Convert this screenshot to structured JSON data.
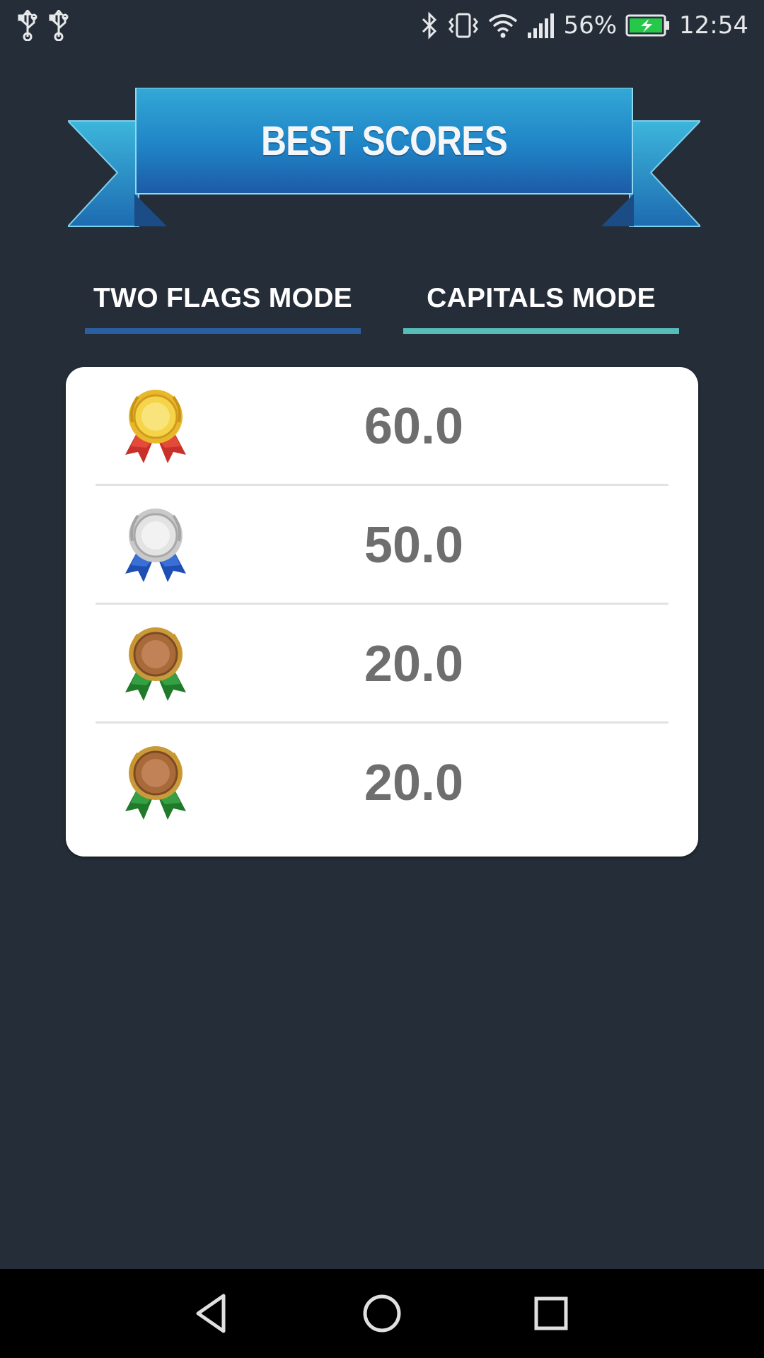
{
  "status_bar": {
    "left_icons": [
      "usb-icon",
      "usb-icon"
    ],
    "right_icons": [
      "bluetooth-icon",
      "vibrate-icon",
      "wifi-icon",
      "signal-icon"
    ],
    "battery": "56%",
    "time": "12:54",
    "battery_icon": "battery-charging-icon"
  },
  "banner": {
    "title": "BEST SCORES"
  },
  "tabs": [
    {
      "label": "TWO FLAGS MODE",
      "underline_color": "#2b5fa3"
    },
    {
      "label": "CAPITALS MODE",
      "underline_color": "#56bdb8"
    }
  ],
  "scores": [
    {
      "medal": "gold-medal-icon",
      "value": "60.0"
    },
    {
      "medal": "silver-medal-icon",
      "value": "50.0"
    },
    {
      "medal": "bronze-medal-icon",
      "value": "20.0"
    },
    {
      "medal": "bronze-medal-icon",
      "value": "20.0"
    }
  ],
  "nav_bar": {
    "buttons": [
      "back-icon",
      "home-icon",
      "recents-icon"
    ]
  },
  "colors": {
    "background": "#252d38",
    "banner_blue": "#1e7fbf",
    "score_text": "#6e6e6e"
  }
}
